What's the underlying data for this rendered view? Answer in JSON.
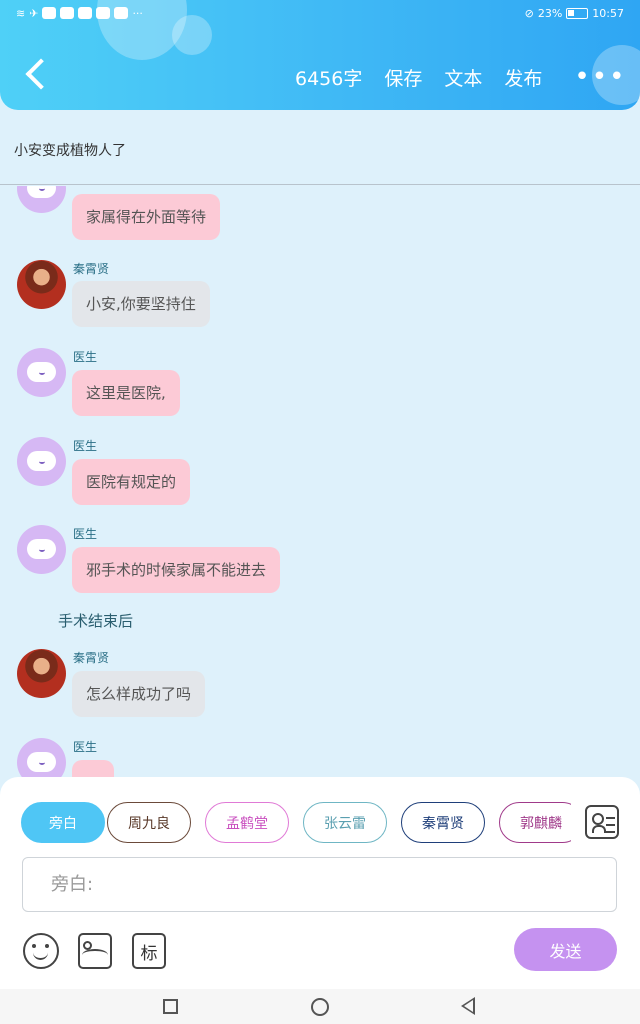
{
  "status": {
    "battery": "23%",
    "time": "10:57",
    "more": "···"
  },
  "header": {
    "word_count": "6456字",
    "save": "保存",
    "text": "文本",
    "publish": "发布",
    "more": "•••"
  },
  "title": "小安变成植物人了",
  "messages": [
    {
      "type": "msg",
      "speaker": "",
      "avatar": "doctor",
      "text": "家属得在外面等待",
      "color": "pink"
    },
    {
      "type": "msg",
      "speaker": "秦霄贤",
      "avatar": "person",
      "text": "小安,你要坚持住",
      "color": "gray"
    },
    {
      "type": "msg",
      "speaker": "医生",
      "avatar": "doctor",
      "text": "这里是医院,",
      "color": "pink"
    },
    {
      "type": "msg",
      "speaker": "医生",
      "avatar": "doctor",
      "text": "医院有规定的",
      "color": "pink"
    },
    {
      "type": "msg",
      "speaker": "医生",
      "avatar": "doctor",
      "text": "邪手术的时候家属不能进去",
      "color": "pink"
    },
    {
      "type": "narration",
      "text": "手术结束后"
    },
    {
      "type": "msg",
      "speaker": "秦霄贤",
      "avatar": "person",
      "text": "怎么样成功了吗",
      "color": "gray"
    },
    {
      "type": "msg",
      "speaker": "医生",
      "avatar": "doctor",
      "text": "",
      "color": "pink"
    }
  ],
  "chips": [
    {
      "label": "旁白",
      "border": "#4fc6f5",
      "text": "#ffffff",
      "bg": "#4fc6f5"
    },
    {
      "label": "周九良",
      "border": "#6b4a3a",
      "text": "#5a3a2a",
      "bg": "#ffffff"
    },
    {
      "label": "孟鹤堂",
      "border": "#e07ad6",
      "text": "#c94fbf",
      "bg": "#ffffff"
    },
    {
      "label": "张云雷",
      "border": "#6fb6c4",
      "text": "#5a9fb0",
      "bg": "#ffffff"
    },
    {
      "label": "秦霄贤",
      "border": "#1f3f7a",
      "text": "#1f3f7a",
      "bg": "#ffffff"
    },
    {
      "label": "郭麒麟",
      "border": "#a03a8a",
      "text": "#a03a8a",
      "bg": "#ffffff"
    }
  ],
  "input": {
    "placeholder": "旁白:"
  },
  "tools": {
    "mark": "标"
  },
  "send": "发送"
}
